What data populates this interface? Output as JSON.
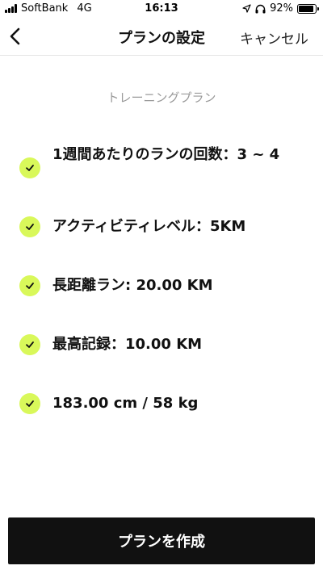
{
  "status_bar": {
    "carrier": "SoftBank",
    "network": "4G",
    "time": "16:13",
    "battery": "92%",
    "battery_level": 0.92
  },
  "header": {
    "title": "プランの設定",
    "cancel_label": "キャンセル",
    "back_icon": "chevron-left-icon"
  },
  "section_title": "トレーニングプラン",
  "plan_items": [
    {
      "text": "1週間あたりのランの回数：3 ~ 4"
    },
    {
      "text": "アクティビティレベル：5KM"
    },
    {
      "text": "長距離ラン: 20.00 KM"
    },
    {
      "text": "最高記録：10.00 KM"
    },
    {
      "text": "183.00 cm / 58 kg"
    }
  ],
  "colors": {
    "accent": "#d9f85a",
    "button_bg": "#111111",
    "muted_text": "#9a9a9a"
  },
  "footer": {
    "create_label": "プランを作成"
  }
}
